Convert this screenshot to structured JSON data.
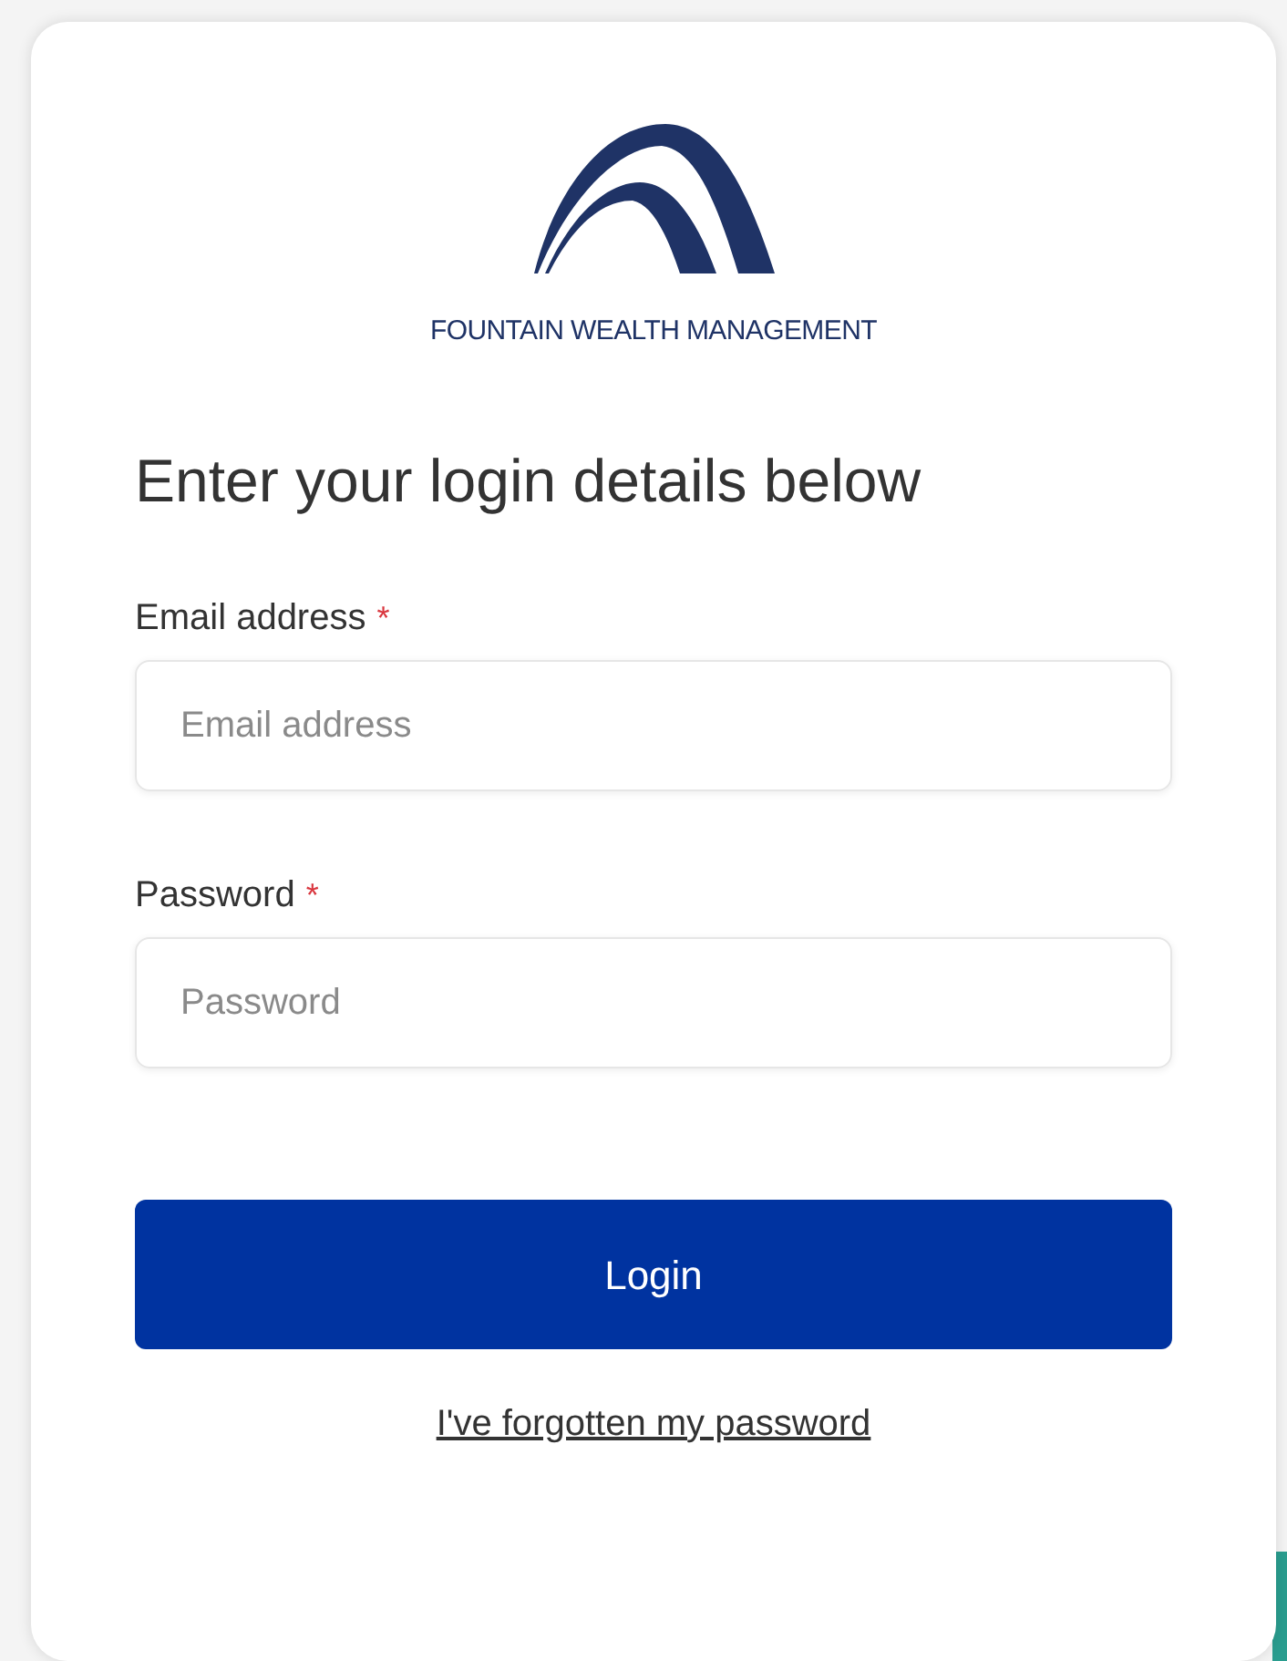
{
  "logo": {
    "text": "FOUNTAIN WEALTH MANAGEMENT"
  },
  "heading": "Enter your login details below",
  "fields": [
    {
      "label": "Email address",
      "required_mark": "*",
      "placeholder": "Email address"
    },
    {
      "label": "Password",
      "required_mark": "*",
      "placeholder": "Password"
    }
  ],
  "button": "Login",
  "link": "I've forgotten my password"
}
